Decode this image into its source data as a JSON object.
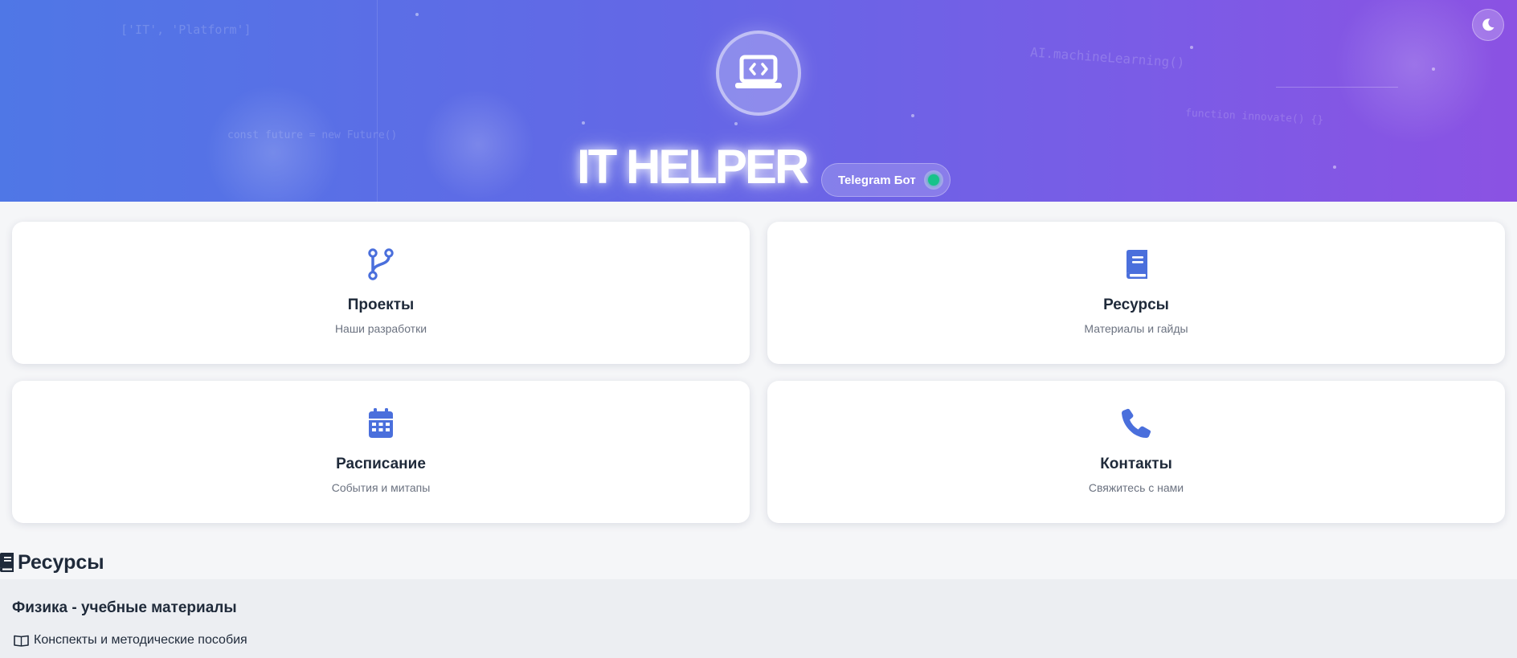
{
  "hero": {
    "brand": "IT HELPER",
    "telegram_badge": "Telegram Бот",
    "code_snippets": [
      "['IT', 'Platform']",
      "AI.machineLearning()",
      "function innovate() {}",
      "const future = new Future()"
    ],
    "logo_icon": "laptop-code-icon",
    "theme_toggle_icon": "moon-icon"
  },
  "cards": [
    {
      "title": "Проекты",
      "subtitle": "Наши разработки",
      "icon": "code-branch-icon"
    },
    {
      "title": "Ресурсы",
      "subtitle": "Материалы и гайды",
      "icon": "book-icon"
    },
    {
      "title": "Расписание",
      "subtitle": "События и митапы",
      "icon": "calendar-icon"
    },
    {
      "title": "Контакты",
      "subtitle": "Свяжитесь с нами",
      "icon": "phone-icon"
    }
  ],
  "resources": {
    "heading": "Ресурсы",
    "panel_title": "Физика - учебные материалы",
    "item": "Конспекты и методические пособия"
  },
  "colors": {
    "accent": "#4a6fdc",
    "hero_start": "#4f77e6",
    "hero_end": "#8b52e3",
    "online": "#17c38a"
  }
}
